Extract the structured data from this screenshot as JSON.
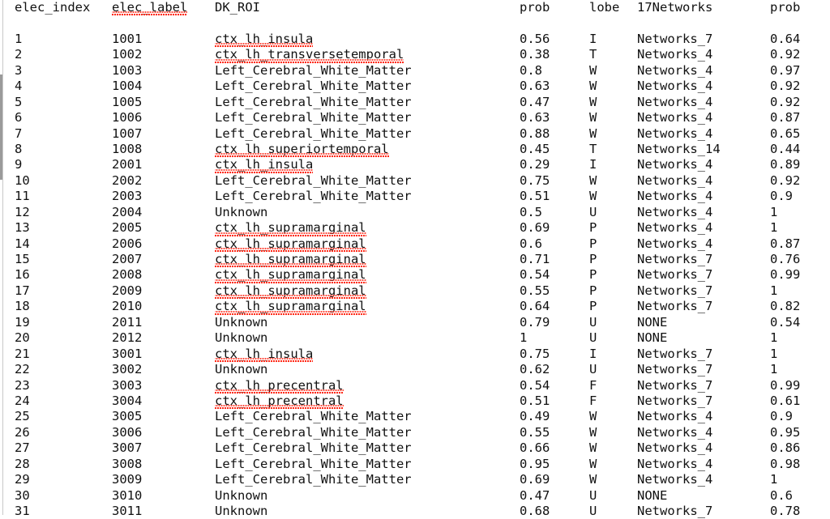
{
  "document": {
    "kind": "plain-text-table",
    "columns": [
      "elec_index",
      "elec_label",
      "DK_ROI",
      "prob",
      "lobe",
      "17Networks",
      "prob"
    ]
  },
  "header": {
    "elec_index": "elec_index",
    "elec_label": "elec_label",
    "dk_roi": "DK_ROI",
    "prob1": "prob",
    "lobe": "lobe",
    "networks17": "17Networks",
    "prob2": "prob"
  },
  "spellcheck": {
    "color": "#ff2a18",
    "misspelled_header_cells": [
      "elec_label"
    ],
    "misspelled_roi_values": [
      "ctx_lh_insula",
      "ctx_lh_transversetemporal",
      "ctx_lh_superiortemporal",
      "ctx_lh_supramarginal",
      "ctx_lh_precentral"
    ]
  },
  "rows": [
    {
      "elec_index": "1",
      "elec_label": "1001",
      "dk_roi": "ctx_lh_insula",
      "roi_misspelled": true,
      "prob1": "0.56",
      "lobe": "I",
      "networks17": "Networks_7",
      "prob2": "0.64"
    },
    {
      "elec_index": "2",
      "elec_label": "1002",
      "dk_roi": "ctx_lh_transversetemporal",
      "roi_misspelled": true,
      "prob1": "0.38",
      "lobe": "T",
      "networks17": "Networks_4",
      "prob2": "0.92"
    },
    {
      "elec_index": "3",
      "elec_label": "1003",
      "dk_roi": "Left_Cerebral_White_Matter",
      "roi_misspelled": false,
      "prob1": "0.8",
      "lobe": "W",
      "networks17": "Networks_4",
      "prob2": "0.97"
    },
    {
      "elec_index": "4",
      "elec_label": "1004",
      "dk_roi": "Left_Cerebral_White_Matter",
      "roi_misspelled": false,
      "prob1": "0.63",
      "lobe": "W",
      "networks17": "Networks_4",
      "prob2": "0.92"
    },
    {
      "elec_index": "5",
      "elec_label": "1005",
      "dk_roi": "Left_Cerebral_White_Matter",
      "roi_misspelled": false,
      "prob1": "0.47",
      "lobe": "W",
      "networks17": "Networks_4",
      "prob2": "0.92"
    },
    {
      "elec_index": "6",
      "elec_label": "1006",
      "dk_roi": "Left_Cerebral_White_Matter",
      "roi_misspelled": false,
      "prob1": "0.63",
      "lobe": "W",
      "networks17": "Networks_4",
      "prob2": "0.87"
    },
    {
      "elec_index": "7",
      "elec_label": "1007",
      "dk_roi": "Left_Cerebral_White_Matter",
      "roi_misspelled": false,
      "prob1": "0.88",
      "lobe": "W",
      "networks17": "Networks_4",
      "prob2": "0.65"
    },
    {
      "elec_index": "8",
      "elec_label": "1008",
      "dk_roi": "ctx_lh_superiortemporal",
      "roi_misspelled": true,
      "prob1": "0.45",
      "lobe": "T",
      "networks17": "Networks_14",
      "prob2": "0.44"
    },
    {
      "elec_index": "9",
      "elec_label": "2001",
      "dk_roi": "ctx_lh_insula",
      "roi_misspelled": true,
      "prob1": "0.29",
      "lobe": "I",
      "networks17": "Networks_4",
      "prob2": "0.89"
    },
    {
      "elec_index": "10",
      "elec_label": "2002",
      "dk_roi": "Left_Cerebral_White_Matter",
      "roi_misspelled": false,
      "prob1": "0.75",
      "lobe": "W",
      "networks17": "Networks_4",
      "prob2": "0.92"
    },
    {
      "elec_index": "11",
      "elec_label": "2003",
      "dk_roi": "Left_Cerebral_White_Matter",
      "roi_misspelled": false,
      "prob1": "0.51",
      "lobe": "W",
      "networks17": "Networks_4",
      "prob2": "0.9"
    },
    {
      "elec_index": "12",
      "elec_label": "2004",
      "dk_roi": "Unknown",
      "roi_misspelled": false,
      "prob1": "0.5",
      "lobe": "U",
      "networks17": "Networks_4",
      "prob2": "1"
    },
    {
      "elec_index": "13",
      "elec_label": "2005",
      "dk_roi": "ctx_lh_supramarginal",
      "roi_misspelled": true,
      "prob1": "0.69",
      "lobe": "P",
      "networks17": "Networks_4",
      "prob2": "1"
    },
    {
      "elec_index": "14",
      "elec_label": "2006",
      "dk_roi": "ctx_lh_supramarginal",
      "roi_misspelled": true,
      "prob1": "0.6",
      "lobe": "P",
      "networks17": "Networks_4",
      "prob2": "0.87"
    },
    {
      "elec_index": "15",
      "elec_label": "2007",
      "dk_roi": "ctx_lh_supramarginal",
      "roi_misspelled": true,
      "prob1": "0.71",
      "lobe": "P",
      "networks17": "Networks_7",
      "prob2": "0.76"
    },
    {
      "elec_index": "16",
      "elec_label": "2008",
      "dk_roi": "ctx_lh_supramarginal",
      "roi_misspelled": true,
      "prob1": "0.54",
      "lobe": "P",
      "networks17": "Networks_7",
      "prob2": "0.99"
    },
    {
      "elec_index": "17",
      "elec_label": "2009",
      "dk_roi": "ctx_lh_supramarginal",
      "roi_misspelled": true,
      "prob1": "0.55",
      "lobe": "P",
      "networks17": "Networks_7",
      "prob2": "1"
    },
    {
      "elec_index": "18",
      "elec_label": "2010",
      "dk_roi": "ctx_lh_supramarginal",
      "roi_misspelled": true,
      "prob1": "0.64",
      "lobe": "P",
      "networks17": "Networks_7",
      "prob2": "0.82"
    },
    {
      "elec_index": "19",
      "elec_label": "2011",
      "dk_roi": "Unknown",
      "roi_misspelled": false,
      "prob1": "0.79",
      "lobe": "U",
      "networks17": "NONE",
      "prob2": "0.54"
    },
    {
      "elec_index": "20",
      "elec_label": "2012",
      "dk_roi": "Unknown",
      "roi_misspelled": false,
      "prob1": "1",
      "lobe": "U",
      "networks17": "NONE",
      "prob2": "1"
    },
    {
      "elec_index": "21",
      "elec_label": "3001",
      "dk_roi": "ctx_lh_insula",
      "roi_misspelled": true,
      "prob1": "0.75",
      "lobe": "I",
      "networks17": "Networks_7",
      "prob2": "1"
    },
    {
      "elec_index": "22",
      "elec_label": "3002",
      "dk_roi": "Unknown",
      "roi_misspelled": false,
      "prob1": "0.62",
      "lobe": "U",
      "networks17": "Networks_7",
      "prob2": "1"
    },
    {
      "elec_index": "23",
      "elec_label": "3003",
      "dk_roi": "ctx_lh_precentral",
      "roi_misspelled": true,
      "prob1": "0.54",
      "lobe": "F",
      "networks17": "Networks_7",
      "prob2": "0.99"
    },
    {
      "elec_index": "24",
      "elec_label": "3004",
      "dk_roi": "ctx_lh_precentral",
      "roi_misspelled": true,
      "prob1": "0.51",
      "lobe": "F",
      "networks17": "Networks_7",
      "prob2": "0.61"
    },
    {
      "elec_index": "25",
      "elec_label": "3005",
      "dk_roi": "Left_Cerebral_White_Matter",
      "roi_misspelled": false,
      "prob1": "0.49",
      "lobe": "W",
      "networks17": "Networks_4",
      "prob2": "0.9"
    },
    {
      "elec_index": "26",
      "elec_label": "3006",
      "dk_roi": "Left_Cerebral_White_Matter",
      "roi_misspelled": false,
      "prob1": "0.55",
      "lobe": "W",
      "networks17": "Networks_4",
      "prob2": "0.95"
    },
    {
      "elec_index": "27",
      "elec_label": "3007",
      "dk_roi": "Left_Cerebral_White_Matter",
      "roi_misspelled": false,
      "prob1": "0.66",
      "lobe": "W",
      "networks17": "Networks_4",
      "prob2": "0.86"
    },
    {
      "elec_index": "28",
      "elec_label": "3008",
      "dk_roi": "Left_Cerebral_White_Matter",
      "roi_misspelled": false,
      "prob1": "0.95",
      "lobe": "W",
      "networks17": "Networks_4",
      "prob2": "0.98"
    },
    {
      "elec_index": "29",
      "elec_label": "3009",
      "dk_roi": "Left_Cerebral_White_Matter",
      "roi_misspelled": false,
      "prob1": "0.69",
      "lobe": "W",
      "networks17": "Networks_4",
      "prob2": "1"
    },
    {
      "elec_index": "30",
      "elec_label": "3010",
      "dk_roi": "Unknown",
      "roi_misspelled": false,
      "prob1": "0.47",
      "lobe": "U",
      "networks17": "NONE",
      "prob2": "0.6"
    },
    {
      "elec_index": "31",
      "elec_label": "3011",
      "dk_roi": "Unknown",
      "roi_misspelled": false,
      "prob1": "0.68",
      "lobe": "U",
      "networks17": "Networks_7",
      "prob2": "0.78"
    }
  ]
}
